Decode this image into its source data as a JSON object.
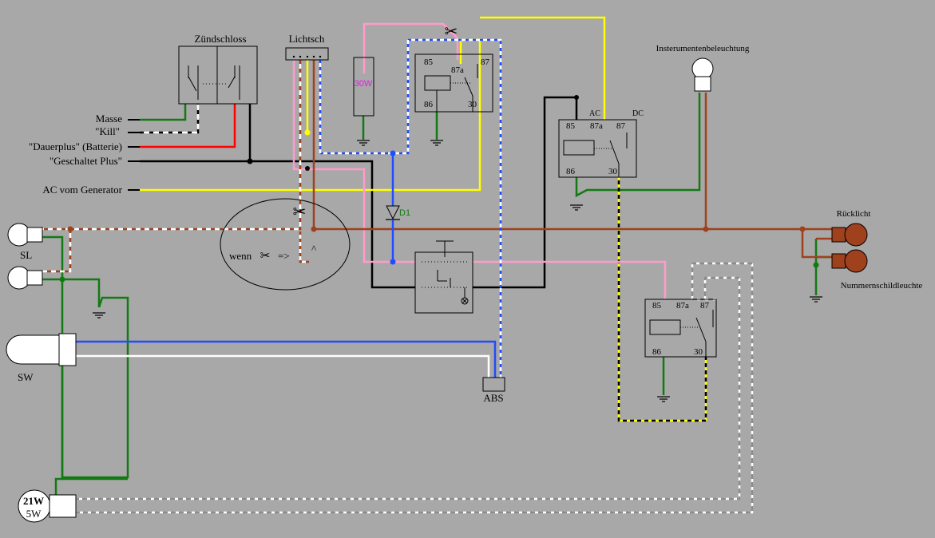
{
  "colors": {
    "background": "#a8a8a8",
    "black": "#000000",
    "green": "#137a13",
    "red": "#ff0000",
    "brown": "#a0411e",
    "yellow": "#ffff00",
    "pink": "#ff9bcb",
    "blue": "#1f4dff",
    "white": "#ffffff",
    "gray": "#a0a0a0",
    "magenta": "#e01ee0"
  },
  "components": {
    "ignition": "Zündschloss",
    "light_switch": "Lichtsch",
    "resistor": "30W",
    "diode": "D1",
    "abs": "ABS",
    "instrument_light": "Insterumentenbeleuchtung",
    "rear_light": "Rücklicht",
    "plate_light": "Nummernschildleuchte",
    "side_light": "SL",
    "headlight": "SW",
    "brake_bulb_top": "21W",
    "brake_bulb_bottom": "5W"
  },
  "inputs": {
    "masse": "Masse",
    "kill": "\"Kill\"",
    "dauerplus": "\"Dauerplus\" (Batterie)",
    "geschaltet": "\"Geschaltet Plus\"",
    "ac": "AC vom Generator"
  },
  "relay_pins": {
    "p85": "85",
    "p87a": "87a",
    "p87": "87",
    "p86": "86",
    "p30": "30",
    "ac": "AC",
    "dc": "DC"
  },
  "notes": {
    "wenn": "wenn",
    "arrow": "=>",
    "caret": "^"
  },
  "icons": {
    "scissors": "✂"
  }
}
